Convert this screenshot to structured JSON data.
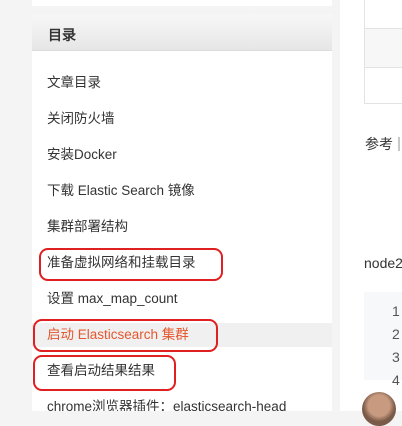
{
  "toc": {
    "title": "目录",
    "items": [
      {
        "label": "文章目录"
      },
      {
        "label": "关闭防火墙"
      },
      {
        "label": "安装Docker"
      },
      {
        "label": "下载 Elastic Search 镜像"
      },
      {
        "label": "集群部署结构"
      },
      {
        "label": "准备虚拟网络和挂载目录"
      },
      {
        "label": "设置 max_map_count"
      },
      {
        "label": "启动 Elasticsearch 集群"
      },
      {
        "label": "查看启动结果结果"
      },
      {
        "label": "chrome浏览器插件：elasticsearch-head"
      }
    ]
  },
  "article": {
    "ref_label": "参考",
    "node_text": "node2",
    "line_numbers": [
      "1",
      "2",
      "3",
      "4"
    ]
  },
  "colors": {
    "active_item": "#e4572e",
    "highlight_box": "#e02020"
  }
}
